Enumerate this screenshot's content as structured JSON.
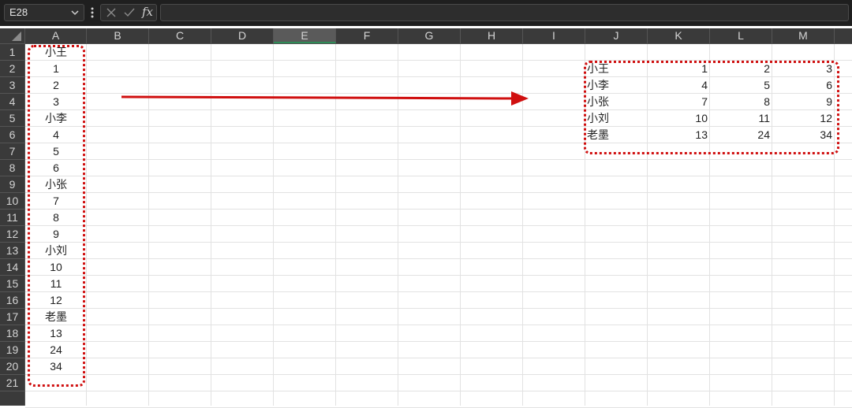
{
  "formula_bar": {
    "name_box": "E28",
    "fx": "fx",
    "formula": ""
  },
  "columns": [
    "A",
    "B",
    "C",
    "D",
    "E",
    "F",
    "G",
    "H",
    "I",
    "J",
    "K",
    "L",
    "M"
  ],
  "selected_column": "E",
  "rows": [
    "1",
    "2",
    "3",
    "4",
    "5",
    "6",
    "7",
    "8",
    "9",
    "10",
    "11",
    "12",
    "13",
    "14",
    "15",
    "16",
    "17",
    "18",
    "19",
    "20",
    "21"
  ],
  "column_a": [
    "小王",
    "1",
    "2",
    "3",
    "小李",
    "4",
    "5",
    "6",
    "小张",
    "7",
    "8",
    "9",
    "小刘",
    "10",
    "11",
    "12",
    "老墨",
    "13",
    "24",
    "34"
  ],
  "result_table": [
    [
      "小王",
      "1",
      "2",
      "3"
    ],
    [
      "小李",
      "4",
      "5",
      "6"
    ],
    [
      "小张",
      "7",
      "8",
      "9"
    ],
    [
      "小刘",
      "10",
      "11",
      "12"
    ],
    [
      "老墨",
      "13",
      "24",
      "34"
    ]
  ],
  "colors": {
    "annotation": "#d01010",
    "header_bg": "#3a3a3a",
    "toolbar_bg": "#1f1f1f"
  }
}
